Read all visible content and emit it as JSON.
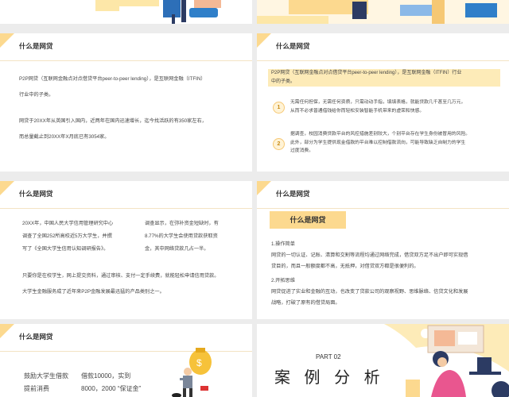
{
  "slide3": {
    "title": "什么是网贷",
    "p1_line1": "P2P网贷（互联网金融点对点借贷平台peer-to-peer lending），是互联网金融（ITFIN）",
    "p1_line2": "行业中的子类。",
    "p2_line1": "网贷于20XX年从英国引入国内，近两年在国内迅速增长，迄今找活跃的有350家左右，",
    "p2_line2": "而总量截止到20XX年X月底已有3054家。"
  },
  "slide4": {
    "title": "什么是网贷",
    "intro_line1": "P2P网贷（互联网金融点对点借贷平台peer-to-peer   lending），是互联网金融（ITFIN）行业",
    "intro_line2": "中的子类。",
    "items": [
      {
        "num": "1",
        "line1": "无需任何担保，无需任何资质，只需动动手指，填填表格，就能贷款几千甚至几万元，",
        "line2": "从而不必求普通借钱给你而轻松安装智能手机带来的虚荣和快感。"
      },
      {
        "num": "2",
        "line1": "据调查，校园消费贷款平台的风控措施差别较大，个别平台存在学生身份被冒用的风险。",
        "line2": "此外，部分为学生提供现金借款的平台难以控制借款流向，可能导致缺乏自制力的学生",
        "line3": "过度消费。"
      }
    ]
  },
  "slide5": {
    "title": "什么是网贷",
    "l1a": "20XX年，中国人民大学信用管理研究中心",
    "l1b": "调查显示，在弥补资金短缺时，有",
    "l2a": "调查了全国252所高校近5万大学生，并撰",
    "l2b": "8.77%的大学生会使用贷款获取资",
    "l3a": "写了《全国大学生信用认知调研报告》。",
    "l3b": "金，其中网络贷款几占一半。",
    "p2": "只要你是在校学生，网上提交资料，通过审核、支付一定手续费，就能轻松申请信用贷款。",
    "p3": "大学生金融服务成了近年来P2P金融发展最迅猛的产品类别之一。"
  },
  "slide6": {
    "title": "什么是网贷",
    "box_title": "什么是网贷",
    "h1": "1.操作简单",
    "b1_1": "网贷的一切认证、记账、清算和交割等流程均通过网络完成，借贷双方足不出户即可实现借",
    "b1_2": "贷目的，而且一般额度都不高，无抵押，对借贷双方都是很便利的。",
    "h2": "2.开拓思维",
    "b2_1": "网贷促进了实业和金融的互动，也改变了贷款公司的观察视野、思维脉络、信贷文化和发展",
    "b2_2": "战略，打破了原有的借贷局面。"
  },
  "slide7": {
    "title": "什么是网贷",
    "row1a": "鼓励大学生借款",
    "row1b": "借款10000，实到",
    "row2a": "提前消费",
    "row2b": "8000，2000 “保证金”",
    "bag_symbol": "$"
  },
  "slide8": {
    "part": "PART 02",
    "heading": "案 例 分 析"
  },
  "colors": {
    "accent": "#fcd98f",
    "accent_light": "#fdebb8",
    "dark_blue": "#2c3b63",
    "person_blue": "#2f7fc9"
  }
}
